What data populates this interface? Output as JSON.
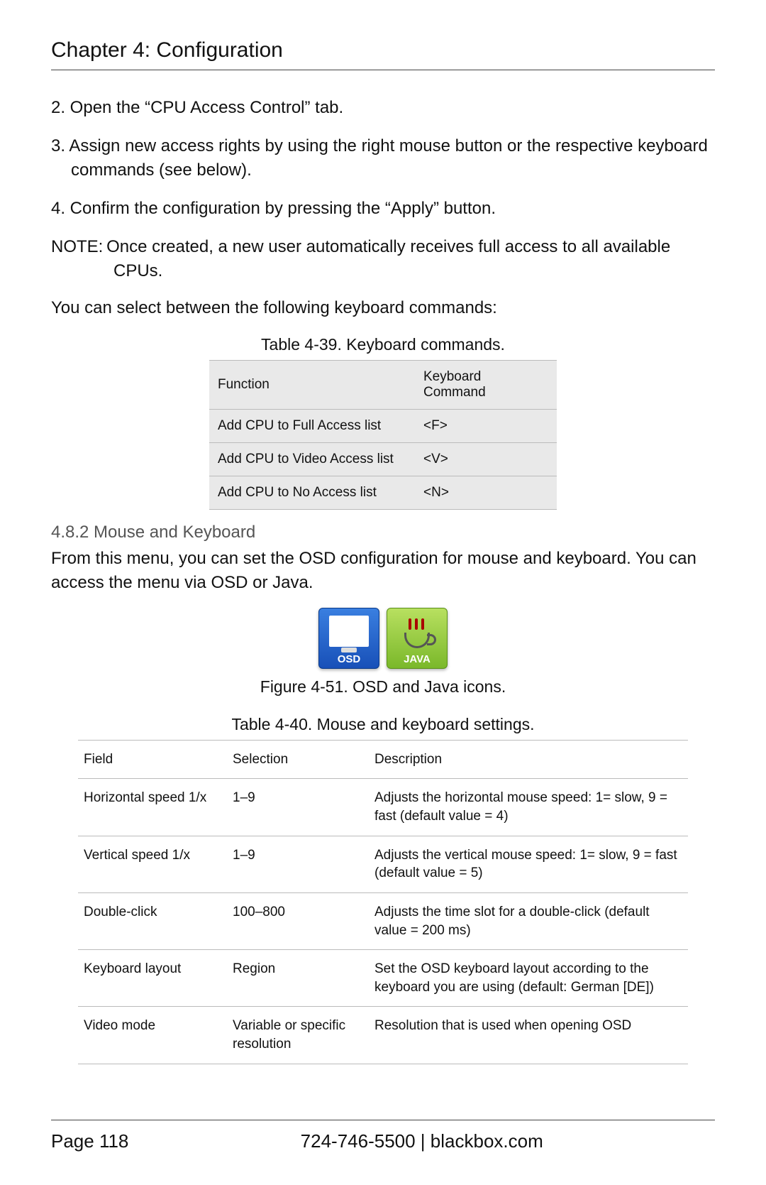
{
  "chapter": "Chapter 4: Configuration",
  "steps": {
    "s2": "2. Open the “CPU Access Control” tab.",
    "s3": "3. Assign new access rights by using the right mouse button or the respective keyboard commands (see below).",
    "s4": "4. Confirm the configuration by pressing the “Apply” button."
  },
  "note": "NOTE: Once created, a new user automatically receives full access to all available CPUs.",
  "lead_in": "You can select between the following keyboard commands:",
  "table39": {
    "caption": "Table 4-39. Keyboard commands.",
    "head": {
      "a": "Function",
      "b": "Keyboard Command"
    },
    "rows": [
      {
        "a": "Add CPU to Full Access list",
        "b": "<F>"
      },
      {
        "a": "Add CPU to Video Access list",
        "b": "<V>"
      },
      {
        "a": "Add CPU to No Access list",
        "b": "<N>"
      }
    ]
  },
  "section482": "4.8.2 Mouse and Keyboard",
  "section482_body": "From this menu, you can set the OSD configuration for mouse and keyboard. You can access the menu via OSD or Java.",
  "icons": {
    "osd": "OSD",
    "java": "JAVA"
  },
  "figure51": "Figure 4-51. OSD and Java icons.",
  "table40": {
    "caption": "Table 4-40. Mouse and keyboard settings.",
    "head": {
      "a": "Field",
      "b": "Selection",
      "c": "Description"
    },
    "rows": [
      {
        "a": "Horizontal speed 1/x",
        "b": "1–9",
        "c": "Adjusts the horizontal mouse speed: 1= slow, 9 = fast (default value = 4)"
      },
      {
        "a": "Vertical speed 1/x",
        "b": "1–9",
        "c": "Adjusts the vertical mouse speed: 1= slow, 9 = fast (default value = 5)"
      },
      {
        "a": "Double-click",
        "b": "100–800",
        "c": "Adjusts the time slot for a double-click (default value = 200 ms)"
      },
      {
        "a": "Keyboard layout",
        "b": "Region",
        "c": "Set the OSD keyboard layout according to the keyboard you are using (default: German [DE])"
      },
      {
        "a": "Video mode",
        "b": "Variable or specific resolution",
        "c": "Resolution that is used when opening OSD"
      }
    ]
  },
  "footer": {
    "page": "Page 118",
    "phone": "724-746-5500",
    "sep": "  |  ",
    "site": "blackbox.com"
  }
}
